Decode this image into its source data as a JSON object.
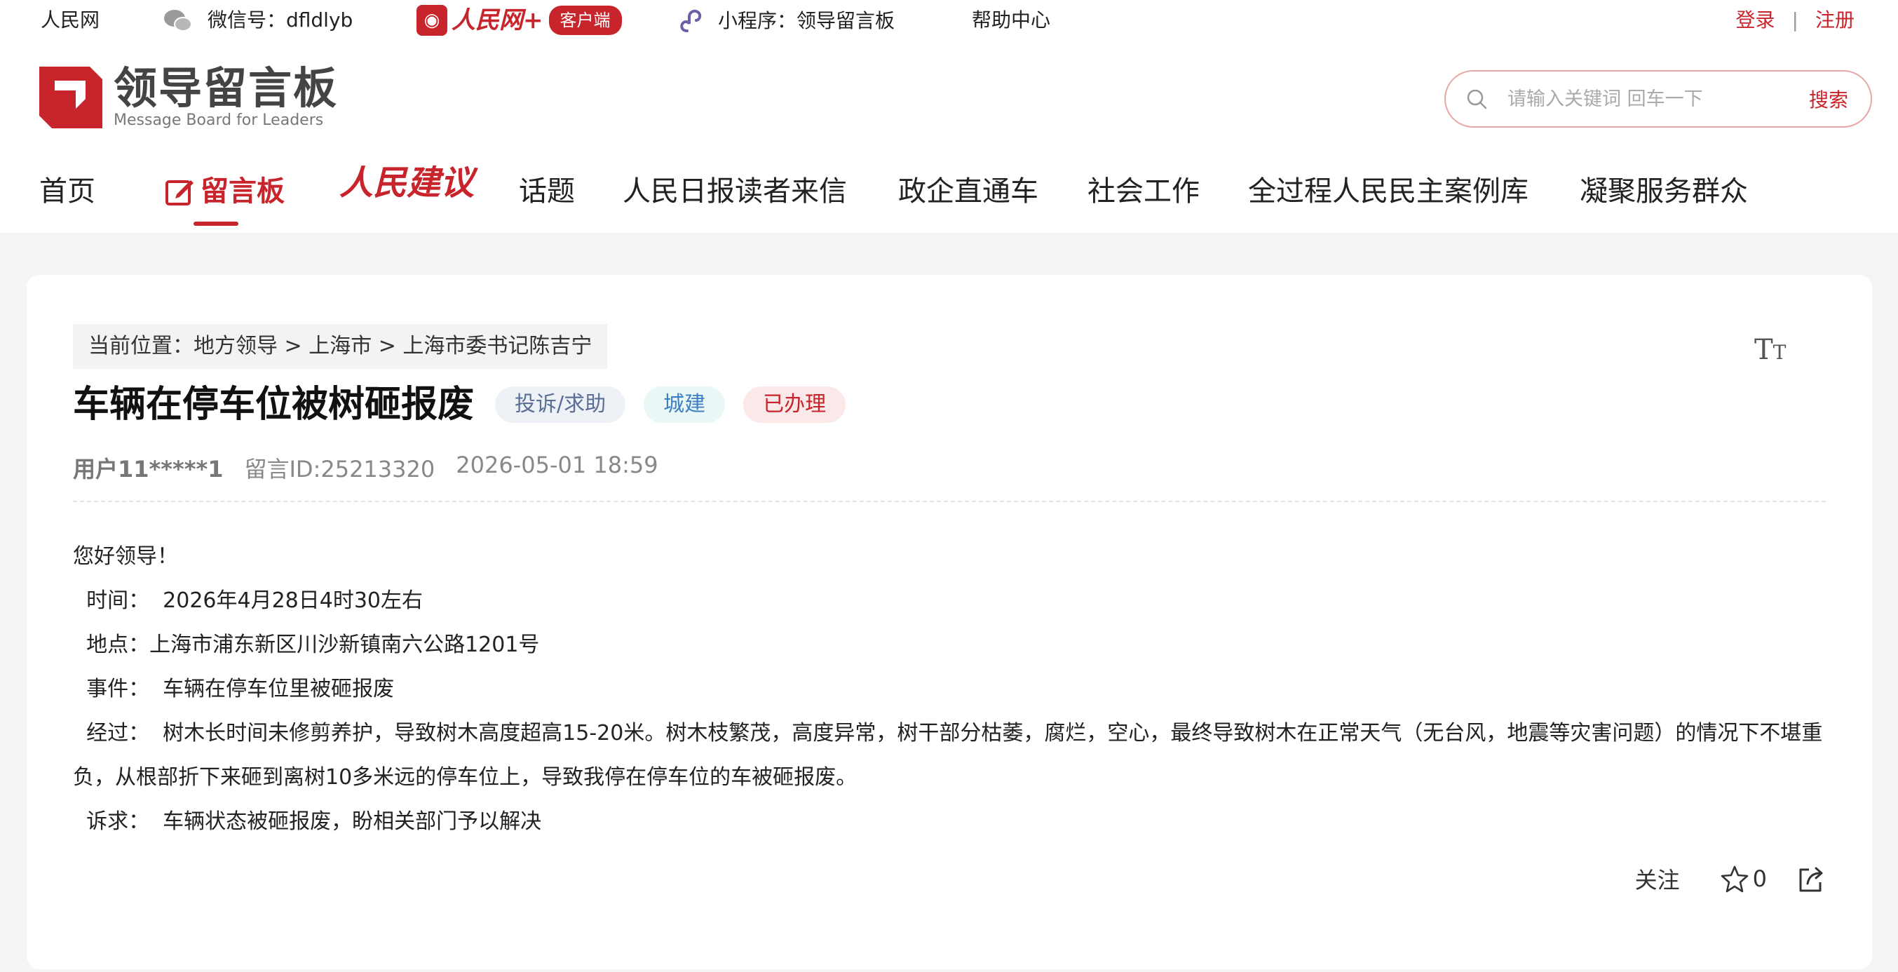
{
  "topbar": {
    "site": "人民网",
    "wechat": "微信号：dfldlyb",
    "app_logo_text": "人民网+",
    "app_badge": "客户端",
    "mini_program": "小程序：领导留言板",
    "help": "帮助中心",
    "login": "登录",
    "separator": "|",
    "register": "注册"
  },
  "header": {
    "logo_cn": "领导留言板",
    "logo_en": "Message Board for Leaders",
    "search_placeholder": "请输入关键词 回车一下",
    "search_button": "搜索"
  },
  "nav": {
    "items": [
      "首页",
      "留言板",
      "人民建议",
      "话题",
      "人民日报读者来信",
      "政企直通车",
      "社会工作",
      "全过程人民民主案例库",
      "凝聚服务群众"
    ]
  },
  "breadcrumb": "当前位置：地方领导 > 上海市 > 上海市委书记陈吉宁",
  "font_size_icon": "T",
  "message": {
    "title": "车辆在停车位被树砸报废",
    "tags": [
      "投诉/求助",
      "城建",
      "已办理"
    ],
    "user": "用户11*****1",
    "msg_id": "留言ID:25213320",
    "datetime": "2026-05-01 18:59",
    "content": [
      "您好领导！",
      "  时间：  2026年4月28日4时30左右",
      "  地点：上海市浦东新区川沙新镇南六公路1201号",
      "  事件：  车辆在停车位里被砸报废",
      "  经过：  树木长时间未修剪养护，导致树木高度超高15-20米。树木枝繁茂，高度异常，树干部分枯萎，腐烂，空心，最终导致树木在正常天气（无台风，地震等灾害问题）的情况下不堪重负，从根部折下来砸到离树10多米远的停车位上，导致我停在停车位的车被砸报废。",
      "  诉求：  车辆状态被砸报废，盼相关部门予以解决"
    ]
  },
  "actions": {
    "follow": "关注",
    "star_count": "0"
  },
  "colors": {
    "brand_red": "#c8242b",
    "page_bg": "#f5f5f5"
  }
}
